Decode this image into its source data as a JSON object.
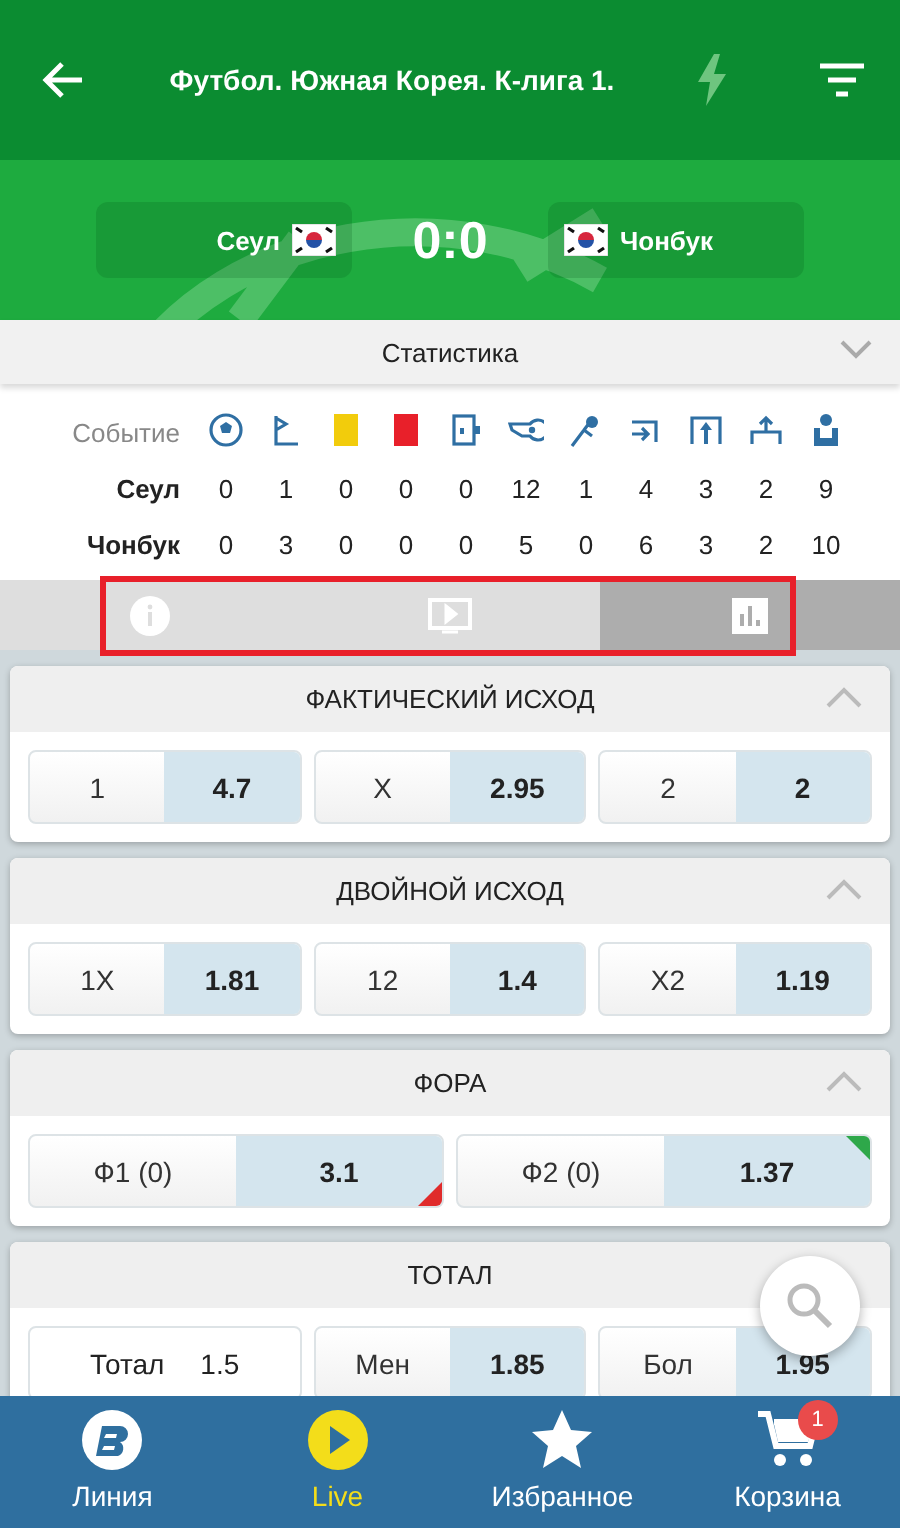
{
  "header": {
    "title": "Футбол. Южная Корея. К-лига 1."
  },
  "match": {
    "home": "Сеул",
    "away": "Чонбук",
    "score": "0:0"
  },
  "stats": {
    "title": "Статистика",
    "event_label": "Событие",
    "columns": [
      {
        "kind": "goal"
      },
      {
        "kind": "corner"
      },
      {
        "kind": "yellow_card"
      },
      {
        "kind": "red_card"
      },
      {
        "kind": "substitution"
      },
      {
        "kind": "whistle"
      },
      {
        "kind": "foul"
      },
      {
        "kind": "throw_in"
      },
      {
        "kind": "goal_kick"
      },
      {
        "kind": "offside"
      },
      {
        "kind": "player"
      }
    ],
    "rows": [
      {
        "team": "Сеул",
        "values": [
          "0",
          "1",
          "0",
          "0",
          "0",
          "12",
          "1",
          "4",
          "3",
          "2",
          "9"
        ]
      },
      {
        "team": "Чонбук",
        "values": [
          "0",
          "3",
          "0",
          "0",
          "0",
          "5",
          "0",
          "6",
          "3",
          "2",
          "10"
        ]
      }
    ]
  },
  "tabs": [
    {
      "kind": "info",
      "selected": false
    },
    {
      "kind": "video",
      "selected": false
    },
    {
      "kind": "stats",
      "selected": true
    }
  ],
  "markets": [
    {
      "title": "ФАКТИЧЕСКИЙ ИСХОД",
      "outcomes": [
        {
          "kind": "bet",
          "label": "1",
          "odds": "4.7"
        },
        {
          "kind": "bet",
          "label": "X",
          "odds": "2.95"
        },
        {
          "kind": "bet",
          "label": "2",
          "odds": "2"
        }
      ]
    },
    {
      "title": "ДВОЙНОЙ ИСХОД",
      "outcomes": [
        {
          "kind": "bet",
          "label": "1X",
          "odds": "1.81"
        },
        {
          "kind": "bet",
          "label": "12",
          "odds": "1.4"
        },
        {
          "kind": "bet",
          "label": "X2",
          "odds": "1.19"
        }
      ]
    },
    {
      "title": "ФОРА",
      "outcomes": [
        {
          "kind": "bet",
          "label": "Ф1 (0)",
          "odds": "3.1",
          "dropped": true,
          "raised": false
        },
        {
          "kind": "bet",
          "label": "Ф2 (0)",
          "odds": "1.37",
          "dropped": false,
          "raised": true
        }
      ]
    },
    {
      "title": "ТОТАЛ",
      "outcomes": [
        {
          "kind": "param",
          "label": "Тотал",
          "odds": "1.5"
        },
        {
          "kind": "bet",
          "label": "Мен",
          "odds": "1.85"
        },
        {
          "kind": "bet",
          "label": "Бол",
          "odds": "1.95"
        }
      ]
    }
  ],
  "nav": [
    {
      "kind": "line",
      "label": "Линия",
      "selected": false
    },
    {
      "kind": "live",
      "label": "Live",
      "selected": true
    },
    {
      "kind": "favorites",
      "label": "Избранное",
      "selected": false
    },
    {
      "kind": "cart",
      "label": "Корзина",
      "selected": false,
      "badge": "1"
    }
  ]
}
